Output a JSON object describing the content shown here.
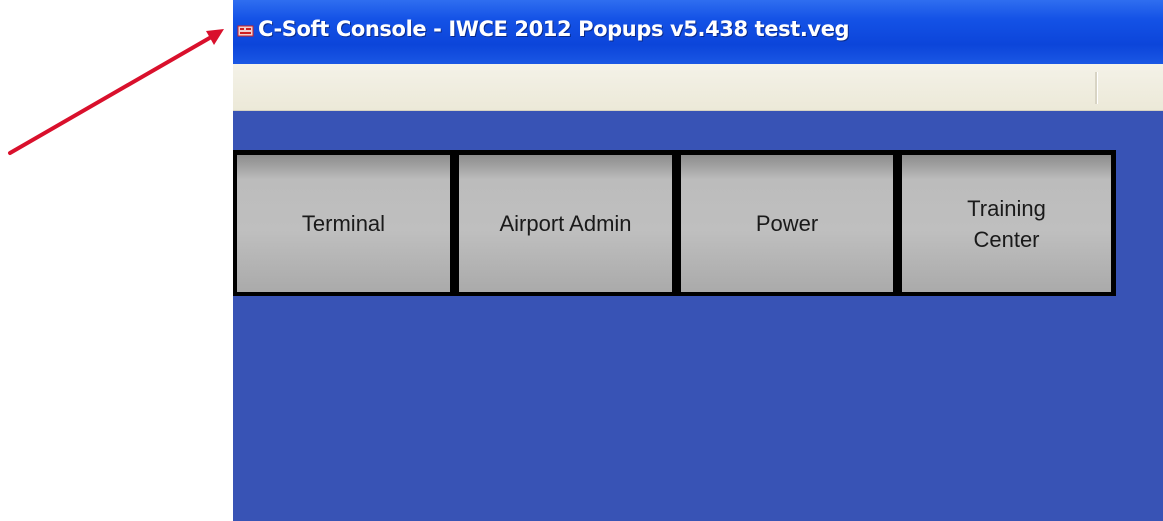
{
  "window": {
    "title": "C-Soft Console - IWCE 2012 Popups v5.438 test.veg",
    "title_icon": "app-icon"
  },
  "annotation": {
    "arrow_icon": "red-arrow-icon",
    "arrow_color": "#d9102c"
  },
  "colors": {
    "titlebar": "#1452e6",
    "toolbar": "#ece9d8",
    "client_background": "#3853b5",
    "button_face": "#bfbfbf",
    "button_border": "#000000"
  },
  "buttons": [
    {
      "label": "Terminal"
    },
    {
      "label": "Airport Admin"
    },
    {
      "label": "Power"
    },
    {
      "label_line1": "Training",
      "label_line2": "Center"
    }
  ]
}
